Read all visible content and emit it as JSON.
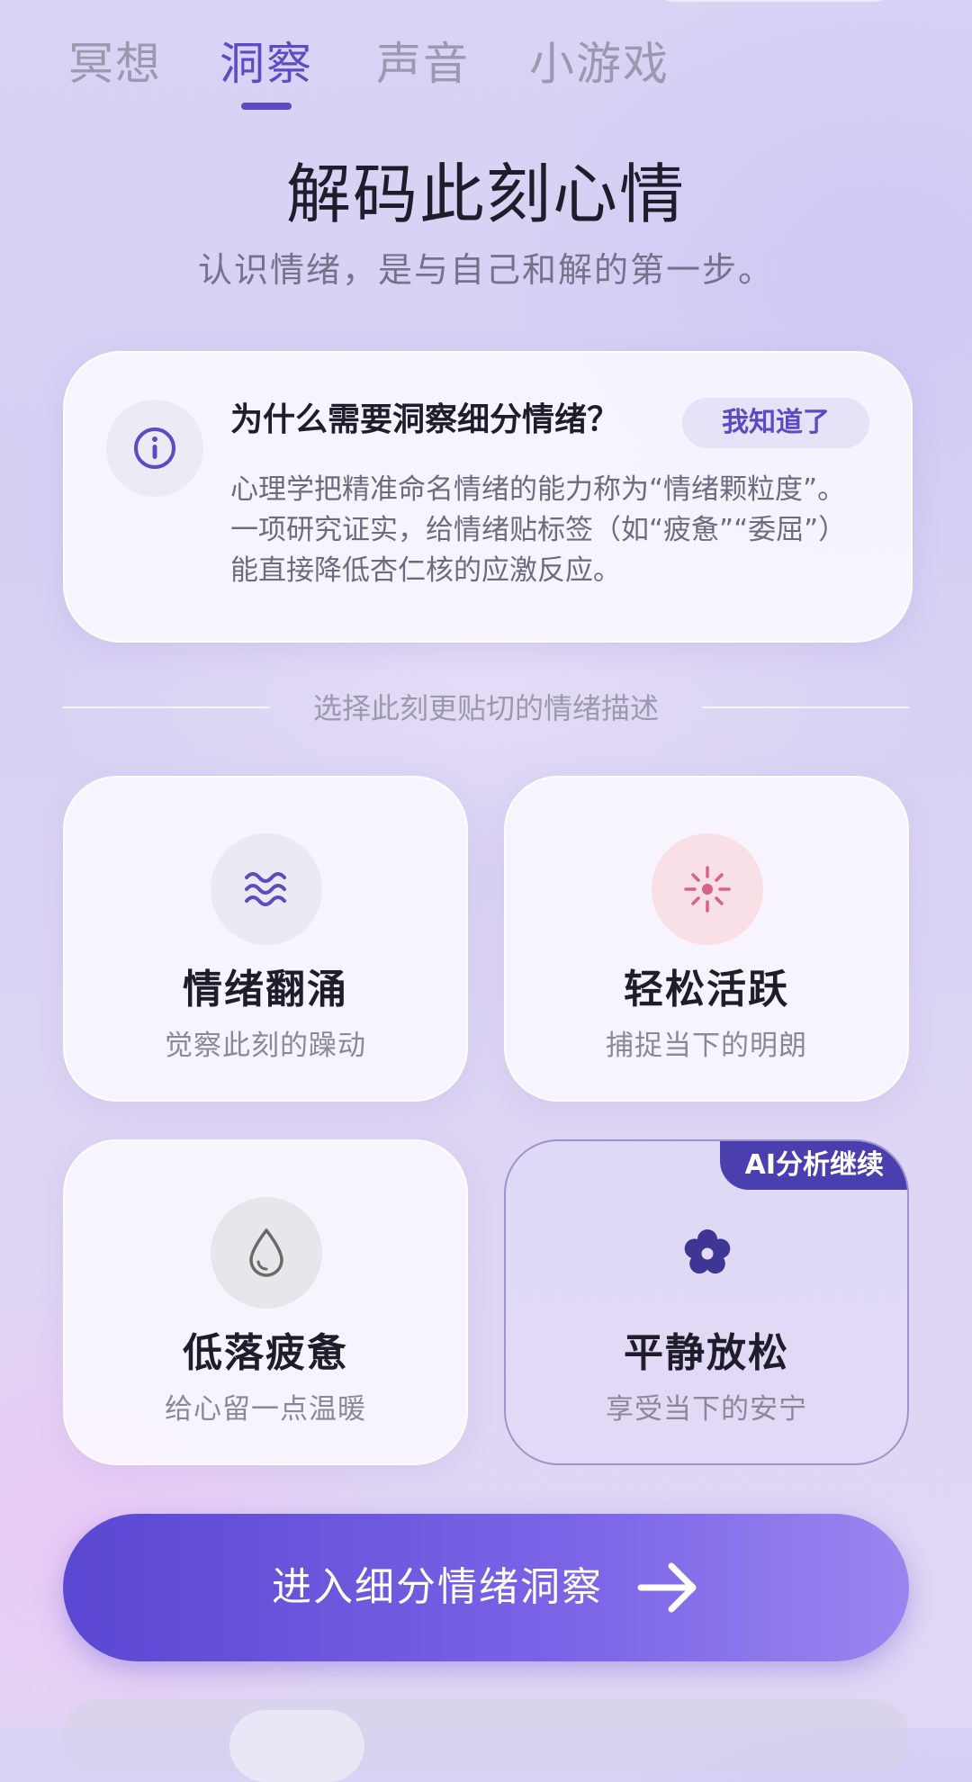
{
  "tabs": [
    {
      "label": "冥想",
      "active": false
    },
    {
      "label": "洞察",
      "active": true
    },
    {
      "label": "声音",
      "active": false
    },
    {
      "label": "小游戏",
      "active": false
    }
  ],
  "header": {
    "title": "解码此刻心情",
    "subtitle": "认识情绪，是与自己和解的第一步。"
  },
  "info_card": {
    "icon": "info-icon",
    "title": "为什么需要洞察细分情绪？",
    "ack_label": "我知道了",
    "body": "心理学把精准命名情绪的能力称为“情绪颗粒度”。一项研究证实，给情绪贴标签（如“疲惫”“委屈”）能直接降低杏仁核的应激反应。"
  },
  "divider_text": "选择此刻更贴切的情绪描述",
  "moods": [
    {
      "title": "情绪翻涌",
      "subtitle": "觉察此刻的躁动",
      "icon": "waves-icon",
      "icon_bg": "#ebe9f3",
      "icon_color": "#5b4cc4",
      "selected": false
    },
    {
      "title": "轻松活跃",
      "subtitle": "捕捉当下的明朗",
      "icon": "sparkle-icon",
      "icon_bg": "#f9dfe6",
      "icon_color": "#d9628a",
      "selected": false
    },
    {
      "title": "低落疲惫",
      "subtitle": "给心留一点温暖",
      "icon": "droplet-icon",
      "icon_bg": "#e7e6ea",
      "icon_color": "#6b6966",
      "selected": false
    },
    {
      "title": "平静放松",
      "subtitle": "享受当下的安宁",
      "icon": "flower-icon",
      "icon_bg": "transparent",
      "icon_color": "#3f3592",
      "selected": true,
      "tag": "AI分析继续"
    }
  ],
  "cta": {
    "label": "进入细分情绪洞察",
    "icon": "arrow-right-icon"
  },
  "colors": {
    "accent": "#5b4cc4",
    "cta_start": "#5a47d2",
    "cta_end": "#9a85f0"
  }
}
